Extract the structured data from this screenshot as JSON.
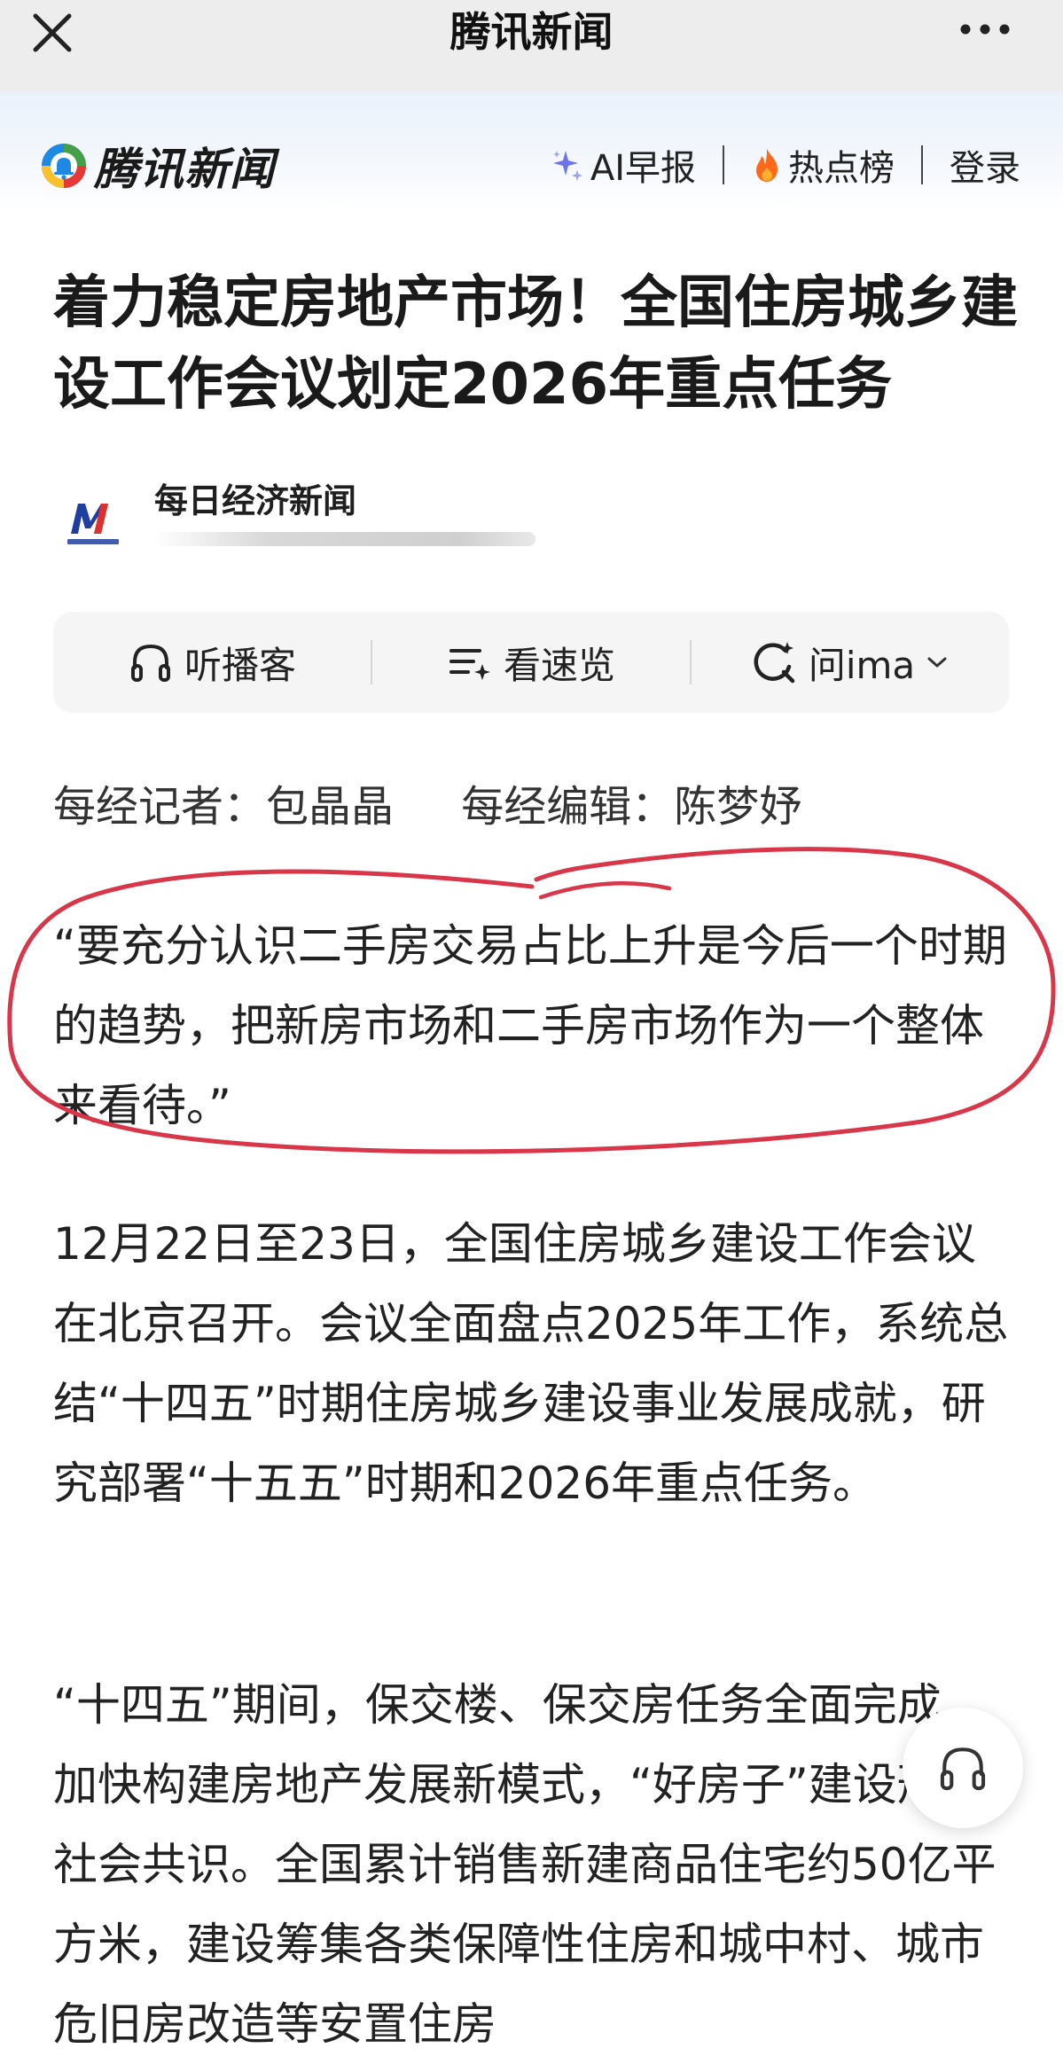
{
  "topbar": {
    "title": "腾讯新闻"
  },
  "header": {
    "logo_text": "腾讯新闻",
    "nav": {
      "ai_brief": "AI早报",
      "hot_list": "热点榜",
      "login": "登录"
    }
  },
  "article": {
    "title": "着力稳定房地产市场！全国住房城乡建设工作会议划定2026年重点任务",
    "source": {
      "publisher": "每日经济新闻"
    },
    "toolbar": {
      "listen": "听播客",
      "summary": "看速览",
      "ask": "问ima"
    },
    "byline": "每经记者：包晶晶     每经编辑：陈梦妤",
    "paragraphs": [
      "“要充分认识二手房交易占比上升是今后一个时期的趋势，把新房市场和二手房市场作为一个整体来看待。”",
      "12月22日至23日，全国住房城乡建设工作会议在北京召开。会议全面盘点2025年工作，系统总结“十四五”时期住房城乡建设事业发展成就，研究部署“十五五”时期和2026年重点任务。",
      "“十四五”期间，保交楼、保交房任务全面完成，加快构建房地产发展新模式，“好房子”建设形成社会共识。全国累计销售新建商品住宅约50亿平方米，建设筹集各类保障性住房和城中村、城市危旧房改造等安置住房"
    ]
  },
  "colors": {
    "annotation": "#d9364a",
    "topbar_bg": "#ededed",
    "toolbar_bg": "#f5f5f5"
  }
}
